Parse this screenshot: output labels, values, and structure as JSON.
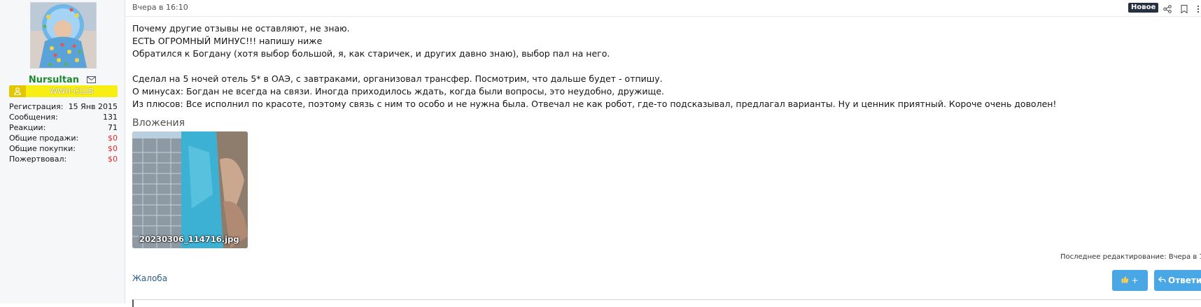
{
  "user": {
    "name": "Nursultan",
    "group": "WWH-CLUB",
    "stats": [
      {
        "label": "Регистрация:",
        "value": "15 Янв 2015",
        "red": false
      },
      {
        "label": "Сообщения:",
        "value": "131",
        "red": false
      },
      {
        "label": "Реакции:",
        "value": "71",
        "red": false
      },
      {
        "label": "Общие продажи:",
        "value": "$0",
        "red": true
      },
      {
        "label": "Общие покупки:",
        "value": "$0",
        "red": true
      },
      {
        "label": "Пожертвовал:",
        "value": "$0",
        "red": true
      }
    ]
  },
  "post": {
    "time": "Вчера в 16:10",
    "badge": "Новое",
    "lines": [
      "Почему другие отзывы не оставляют, не знаю.",
      "ЕСТЬ ОГРОМНЫЙ МИНУС!!! напишу ниже",
      "Обратился к Богдану (хотя выбор большой, я, как старичек, и других давно знаю), выбор пал на него.",
      "",
      "Сделал на 5 ночей отель 5* в ОАЭ, с завтраками, организовал трансфер. Посмотрим, что дальше будет - отпишу.",
      "О минусах: Богдан не всегда на связи. Иногда приходилось ждать, когда были вопросы, это неудобно, дружище.",
      "Из плюсов: Все исполнил по красоте, поэтому связь с ним то особо и не нужна была. Отвечал не как робот, где-то подсказывал, предлагал варианты. Ну и ценник приятный. Короче очень доволен!"
    ],
    "attachments_title": "Вложения",
    "attachment_name": "20230306_114716.jpg",
    "edit_note": "Последнее редактирование: Вчера в 1",
    "report_label": "Жалоба",
    "like_label": "+",
    "reply_label": "Ответи"
  },
  "colors": {
    "accent": "#4aa7e6",
    "username": "#1e8a2f",
    "banner": "#f7ef14",
    "negative": "#e52b2b"
  },
  "icons": [
    "envelope-icon",
    "user-icon",
    "share-icon",
    "bookmark-icon",
    "more-icon",
    "thumbs-up-icon",
    "reply-icon"
  ]
}
